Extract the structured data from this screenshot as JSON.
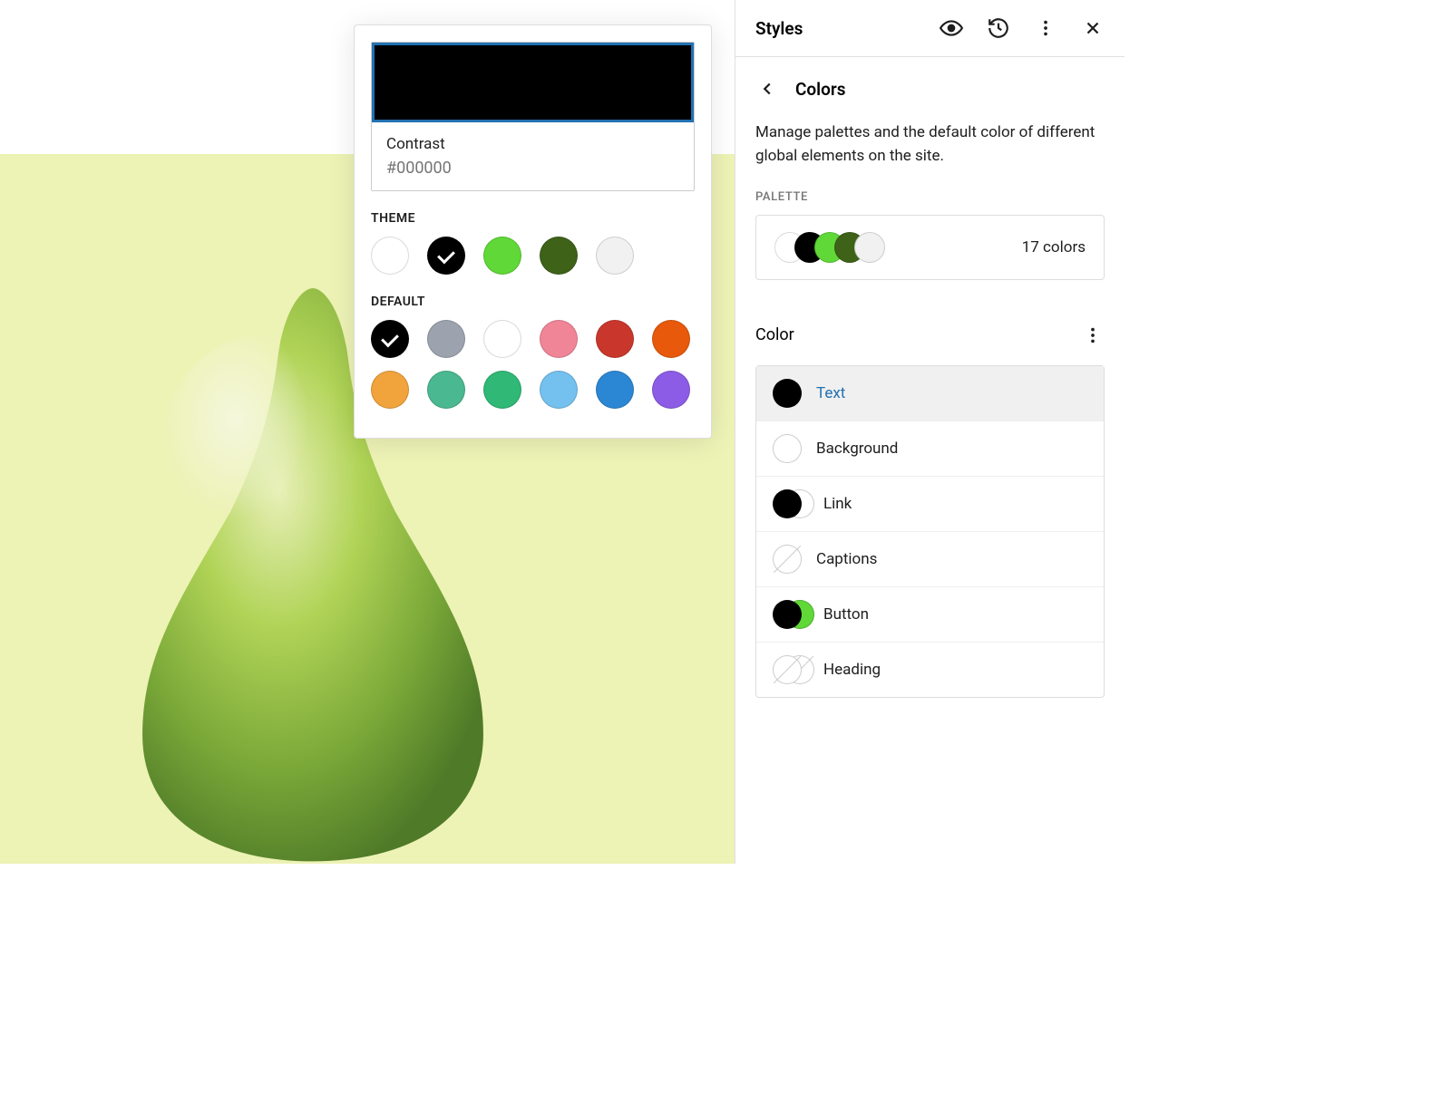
{
  "sidebar": {
    "title": "Styles",
    "nav_title": "Colors",
    "description": "Manage palettes and the default color of different global elements on the site.",
    "palette_label": "PALETTE",
    "palette_count": "17 colors",
    "palette_preview": [
      "#ffffff",
      "#000000",
      "#60D838",
      "#3E6218",
      "#f1f1f1"
    ],
    "color_heading": "Color",
    "elements": [
      {
        "label": "Text",
        "active": true,
        "type": "single",
        "colors": [
          "#000000"
        ]
      },
      {
        "label": "Background",
        "type": "single",
        "colors": [
          "#ffffff"
        ]
      },
      {
        "label": "Link",
        "type": "dual",
        "colors": [
          "#000000",
          "#ffffff"
        ]
      },
      {
        "label": "Captions",
        "type": "none"
      },
      {
        "label": "Button",
        "type": "dual",
        "colors": [
          "#000000",
          "#60D838"
        ]
      },
      {
        "label": "Heading",
        "type": "dual-none"
      }
    ]
  },
  "popover": {
    "current": {
      "name": "Contrast",
      "hex": "#000000",
      "swatch": "#000000"
    },
    "theme_label": "THEME",
    "default_label": "DEFAULT",
    "theme": [
      {
        "c": "#ffffff",
        "sel": false
      },
      {
        "c": "#000000",
        "sel": true
      },
      {
        "c": "#60D838",
        "sel": false
      },
      {
        "c": "#3E6218",
        "sel": false
      },
      {
        "c": "#f1f1f1",
        "sel": false
      }
    ],
    "default": [
      {
        "c": "#000000",
        "sel": true
      },
      {
        "c": "#9ca3af",
        "sel": false
      },
      {
        "c": "#ffffff",
        "sel": false
      },
      {
        "c": "#f08597",
        "sel": false
      },
      {
        "c": "#c9372c",
        "sel": false
      },
      {
        "c": "#e8590c",
        "sel": false
      },
      {
        "c": "#f1a33c",
        "sel": false
      },
      {
        "c": "#4ab890",
        "sel": false
      },
      {
        "c": "#2fb876",
        "sel": false
      },
      {
        "c": "#74c0ee",
        "sel": false
      },
      {
        "c": "#2b87d3",
        "sel": false
      },
      {
        "c": "#8c5ce6",
        "sel": false
      }
    ]
  }
}
